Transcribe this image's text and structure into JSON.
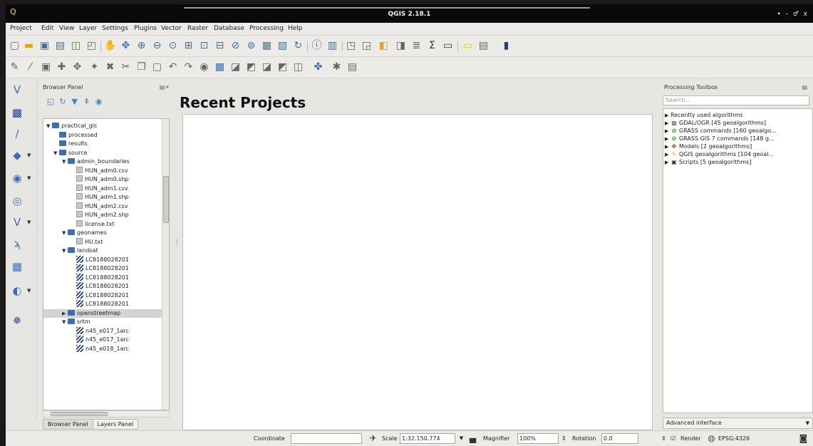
{
  "window": {
    "title": "QGIS 2.18.1",
    "controls": "• - ♂ x"
  },
  "menu": [
    "Project",
    "Edit",
    "View",
    "Layer",
    "Settings",
    "Plugins",
    "Vector",
    "Raster",
    "Database",
    "Processing",
    "Help"
  ],
  "browser": {
    "title": "Browser Panel",
    "tree": [
      {
        "label": "practical_gis",
        "icon": "folder",
        "arrow": "▼"
      },
      {
        "label": "processed",
        "icon": "folder",
        "arrow": ""
      },
      {
        "label": "results",
        "icon": "folder",
        "arrow": ""
      },
      {
        "label": "source",
        "icon": "folder",
        "arrow": "▼"
      },
      {
        "label": "admin_boundaries",
        "icon": "folder",
        "arrow": "▼"
      },
      {
        "label": "HUN_adm0.csv",
        "icon": "file",
        "arrow": ""
      },
      {
        "label": "HUN_adm0.shp",
        "icon": "file",
        "arrow": ""
      },
      {
        "label": "HUN_adm1.csv",
        "icon": "file",
        "arrow": ""
      },
      {
        "label": "HUN_adm1.shp",
        "icon": "file",
        "arrow": ""
      },
      {
        "label": "HUN_adm2.csv",
        "icon": "file",
        "arrow": ""
      },
      {
        "label": "HUN_adm2.shp",
        "icon": "file",
        "arrow": ""
      },
      {
        "label": "license.txt",
        "icon": "file",
        "arrow": ""
      },
      {
        "label": "geonames",
        "icon": "folder",
        "arrow": "▼"
      },
      {
        "label": "HU.txt",
        "icon": "file",
        "arrow": ""
      },
      {
        "label": "landsat",
        "icon": "folder",
        "arrow": "▼"
      },
      {
        "label": "LC8188028201",
        "icon": "raster",
        "arrow": ""
      },
      {
        "label": "LC8188028201",
        "icon": "raster",
        "arrow": ""
      },
      {
        "label": "LC8188028201",
        "icon": "raster",
        "arrow": ""
      },
      {
        "label": "LC8188028201",
        "icon": "raster",
        "arrow": ""
      },
      {
        "label": "LC8188028201",
        "icon": "raster",
        "arrow": ""
      },
      {
        "label": "LC8188028201",
        "icon": "raster",
        "arrow": ""
      },
      {
        "label": "openstreetmap",
        "icon": "folder",
        "arrow": "▶",
        "selected": true
      },
      {
        "label": "srtm",
        "icon": "folder",
        "arrow": "▼"
      },
      {
        "label": "n45_e017_1arc",
        "icon": "raster",
        "arrow": ""
      },
      {
        "label": "n45_e017_1arc",
        "icon": "raster",
        "arrow": ""
      },
      {
        "label": "n45_e018_1arc",
        "icon": "raster",
        "arrow": ""
      }
    ],
    "tabs": [
      "Browser Panel",
      "Layers Panel"
    ]
  },
  "center": {
    "title": "Recent Projects"
  },
  "processing": {
    "title": "Processing Toolbox",
    "search_placeholder": "Search...",
    "items": [
      {
        "label": "Recently used algorithms",
        "icon": ""
      },
      {
        "label": "GDAL/OGR [45 geoalgorithms]",
        "icon": "gdal-icon"
      },
      {
        "label": "GRASS commands [160 geoalgo...",
        "icon": "grass-icon"
      },
      {
        "label": "GRASS GIS 7 commands [148 g...",
        "icon": "grass-icon"
      },
      {
        "label": "Models [2 geoalgorithms]",
        "icon": "models-icon"
      },
      {
        "label": "QGIS geoalgorithms [104 geoal...",
        "icon": "qgis-icon"
      },
      {
        "label": "Scripts [5 geoalgorithms]",
        "icon": "scripts-icon"
      }
    ],
    "advanced": "Advanced interface"
  },
  "status": {
    "coordinate_label": "Coordinate",
    "coordinate_value": "",
    "scale_label": "Scale",
    "scale_value": "1:32.150.774",
    "magnifier_label": "Magnifier",
    "magnifier_value": "100%",
    "rotation_label": "Rotation",
    "rotation_value": "0.0",
    "render_label": "Render",
    "crs_label": "EPSG:4326"
  },
  "colors": {
    "accent_blue": "#3d6fb0",
    "titlebar": "#0a0a0a"
  }
}
